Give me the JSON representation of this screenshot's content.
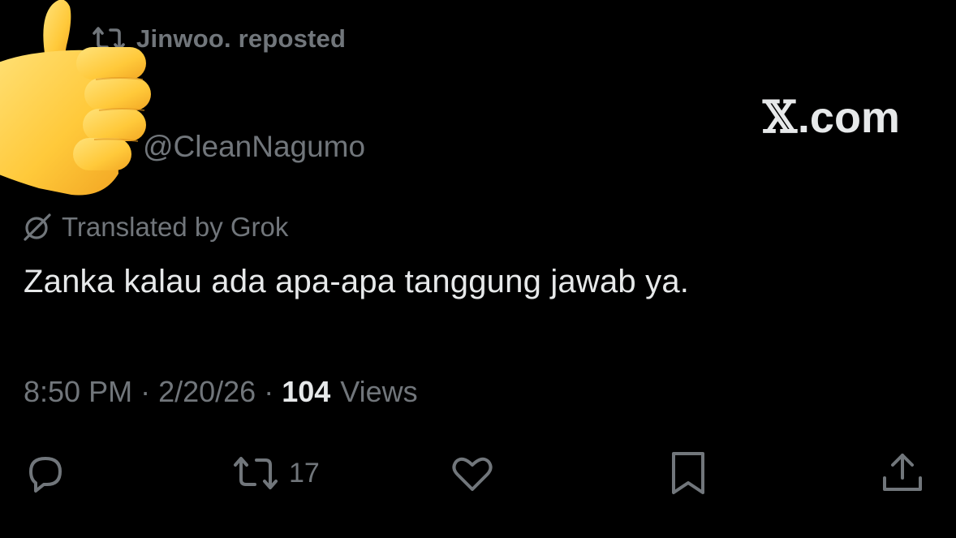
{
  "header": {
    "reposted_by": "Jinwoo. reposted",
    "repost_icon": "repost-icon"
  },
  "overlay": {
    "emoji": "thumbs-up-emoji"
  },
  "author": {
    "handle": "@CleanNagumo"
  },
  "watermark": {
    "x_glyph": "𝕏",
    "domain": ".com"
  },
  "translation": {
    "label": "Translated by Grok",
    "icon": "grok-icon"
  },
  "tweet": {
    "text": "Zanka kalau ada apa-apa tanggung jawab ya."
  },
  "meta": {
    "time": "8:50 PM",
    "separator": "·",
    "date": "2/20/26",
    "views_count": "104",
    "views_label": "Views"
  },
  "actions": {
    "reply_icon": "reply-icon",
    "retweet_icon": "retweet-icon",
    "retweet_count": "17",
    "like_icon": "heart-icon",
    "bookmark_icon": "bookmark-icon",
    "share_icon": "share-icon"
  },
  "colors": {
    "background": "#000000",
    "primary_text": "#e7e9ea",
    "secondary_text": "#71767b",
    "emoji_yellow": "#ffcc33"
  }
}
